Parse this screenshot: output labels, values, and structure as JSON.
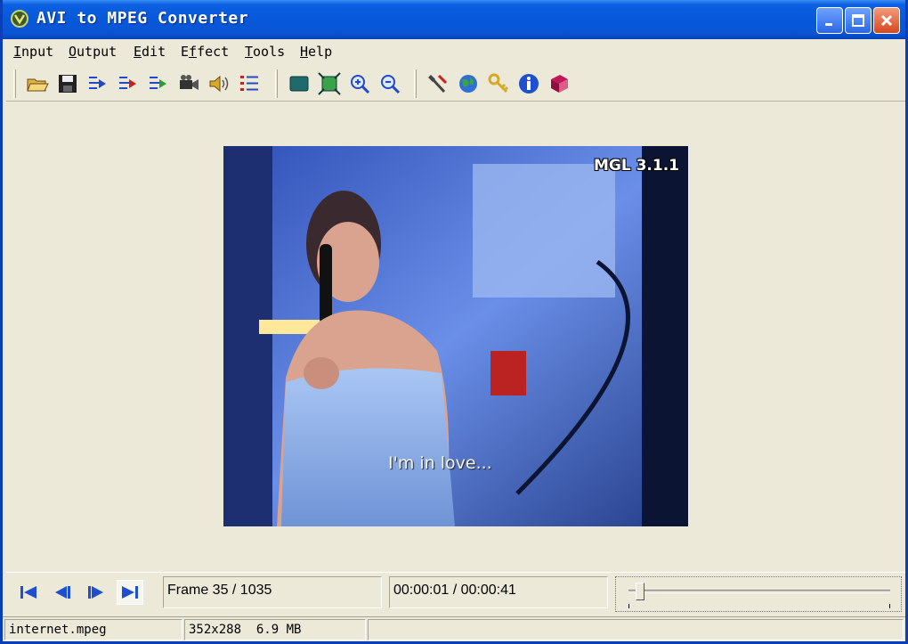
{
  "window": {
    "title": "AVI to MPEG Converter",
    "title_bar_color": "#0858da",
    "face_color": "#ece9d8",
    "icons": [
      "app-icon",
      "minimize-icon",
      "maximize-icon",
      "close-icon"
    ]
  },
  "menu": {
    "items": [
      {
        "accel": "I",
        "rest": "nput"
      },
      {
        "accel": "O",
        "rest": "utput"
      },
      {
        "accel": "E",
        "rest": "dit"
      },
      {
        "accel": "",
        "pre": "E",
        "mid": "f",
        "rest": "fect"
      },
      {
        "accel": "T",
        "rest": "ools"
      },
      {
        "accel": "H",
        "rest": "elp"
      }
    ]
  },
  "toolbar": {
    "groups": [
      [
        "open-folder-icon",
        "save-icon",
        "convert-arrow-icon",
        "convert-arrow-red-icon",
        "convert-arrow-green-icon",
        "video-camera-icon",
        "speaker-icon",
        "list-icon"
      ],
      [
        "display-icon",
        "fit-screen-icon",
        "zoom-in-icon",
        "zoom-out-icon"
      ],
      [
        "tools-icon",
        "globe-icon",
        "key-icon",
        "info-icon",
        "book-icon"
      ]
    ]
  },
  "video": {
    "watermark": "MGL 3.1.1",
    "subtitle": "I'm in love..."
  },
  "controls": {
    "buttons": [
      "first-frame-icon",
      "previous-frame-icon",
      "next-frame-icon",
      "last-frame-icon"
    ],
    "frame_text": "Frame 35 / 1035",
    "time_text": "00:00:01 / 00:00:41",
    "position_fraction": 0.034
  },
  "status": {
    "filename": "internet.mpeg",
    "info": "352x288  6.9 MB"
  }
}
